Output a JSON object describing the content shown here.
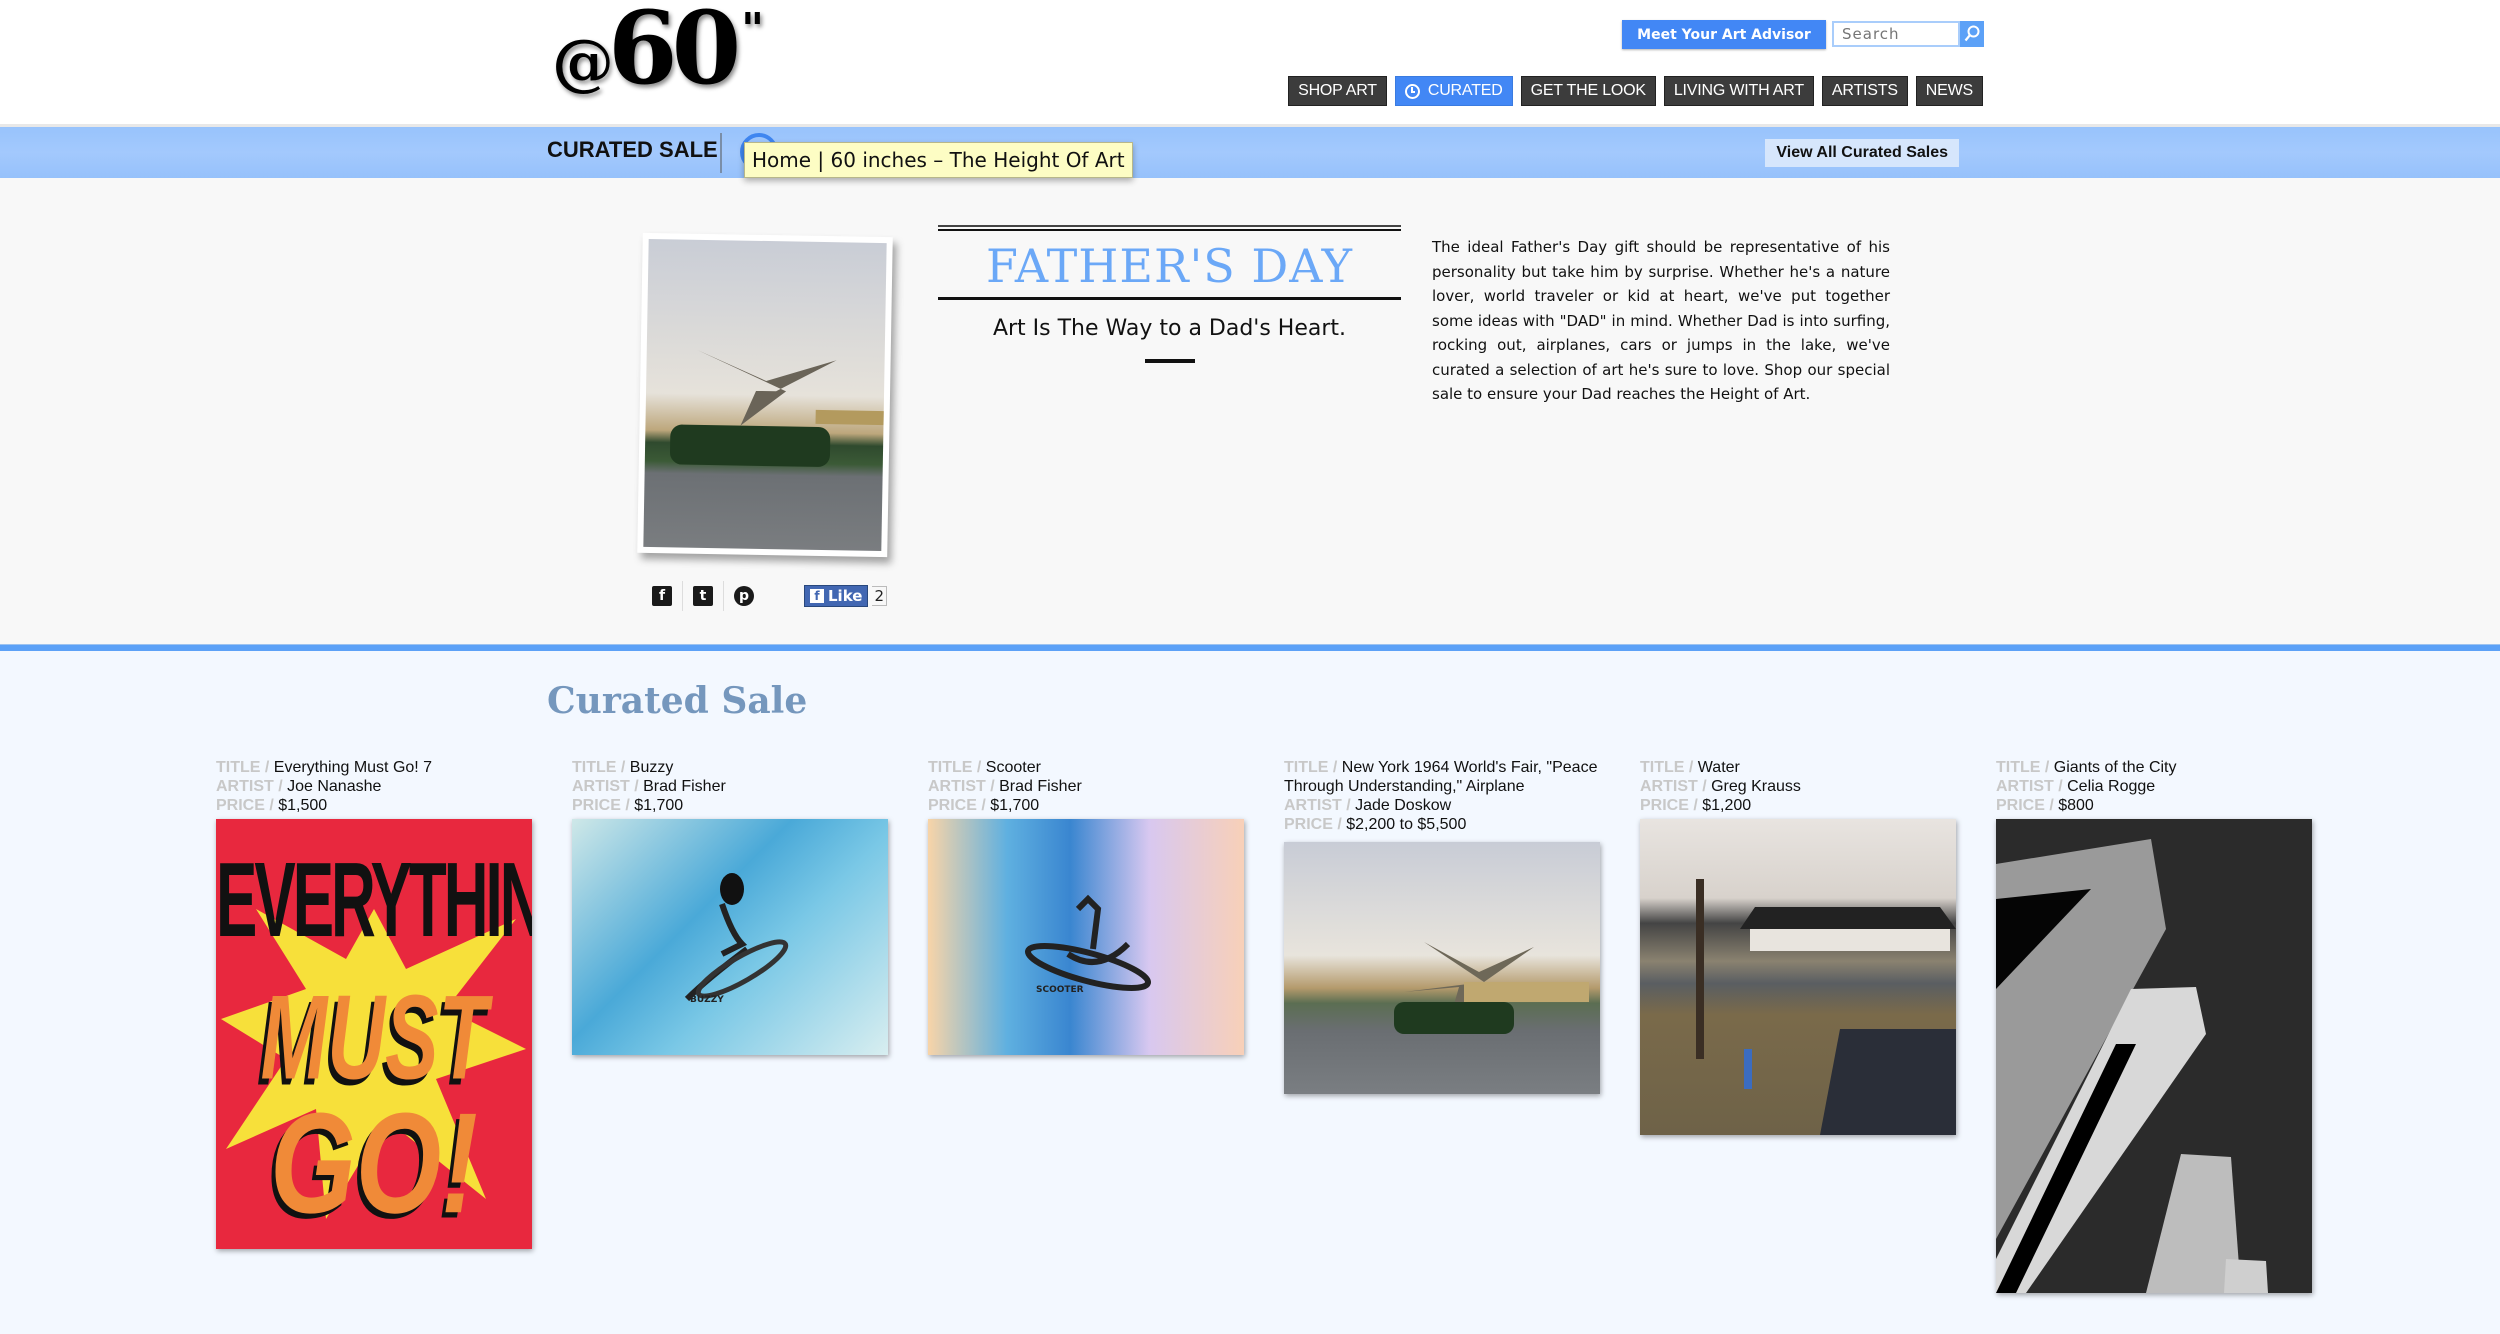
{
  "header": {
    "logo": {
      "at": "@",
      "number": "60",
      "mark": "\""
    },
    "advisor_button": "Meet Your Art Advisor",
    "search": {
      "placeholder": "Search",
      "value": ""
    },
    "search_icon": "magnifier-icon",
    "nav": [
      {
        "label": "SHOP ART",
        "active": false
      },
      {
        "label": "CURATED",
        "active": true,
        "icon": "clock-icon"
      },
      {
        "label": "GET THE LOOK",
        "active": false
      },
      {
        "label": "LIVING WITH ART",
        "active": false
      },
      {
        "label": "ARTISTS",
        "active": false
      },
      {
        "label": "NEWS",
        "active": false
      }
    ]
  },
  "subbar": {
    "title": "CURATED SALE",
    "view_all": "View All Curated Sales"
  },
  "tooltip": "Home | 60 inches – The Height Of Art",
  "feature": {
    "title": "FATHER'S DAY",
    "subtitle": "Art Is The Way to a Dad's Heart.",
    "description": "The ideal Father's Day gift should be representative of his personality but take him by surprise. Whether he's a nature lover, world traveler or kid at heart, we've put together some ideas with \"DAD\" in mind. Whether Dad is into surfing, rocking out, airplanes, cars or jumps in the lake, we've curated a selection of art he's sure to love. Shop our special sale to ensure your Dad reaches the Height of Art.",
    "share": {
      "facebook": "f",
      "twitter": "t",
      "pinterest": "p",
      "like_label": "Like",
      "like_count": "2"
    }
  },
  "curated": {
    "section_title": "Curated Sale",
    "labels": {
      "title": "TITLE / ",
      "artist": "ARTIST / ",
      "price": "PRICE / "
    },
    "items": [
      {
        "title": "Everything Must Go! 7",
        "artist": "Joe Nanashe",
        "price": "$1,500"
      },
      {
        "title": "Buzzy",
        "artist": "Brad Fisher",
        "price": "$1,700"
      },
      {
        "title": "Scooter",
        "artist": "Brad Fisher",
        "price": "$1,700"
      },
      {
        "title": "New York 1964 World's Fair, \"Peace Through Understanding,\" Airplane",
        "artist": "Jade Doskow",
        "price": "$2,200 to $5,500"
      },
      {
        "title": "Water",
        "artist": "Greg Krauss",
        "price": "$1,200"
      },
      {
        "title": "Giants of the City",
        "artist": "Celia Rogge",
        "price": "$800"
      }
    ],
    "art_text": {
      "line1": "EVERYTHING",
      "line2": "MUST",
      "line3": "GO!",
      "buzzy_sig": "BUZZY",
      "scooter_sig": "SCOOTER"
    }
  },
  "colors": {
    "accent": "#4287f5",
    "subbar": "#a0c8fc",
    "section_title": "#7597bd",
    "feature_title": "#6ba8f7"
  }
}
